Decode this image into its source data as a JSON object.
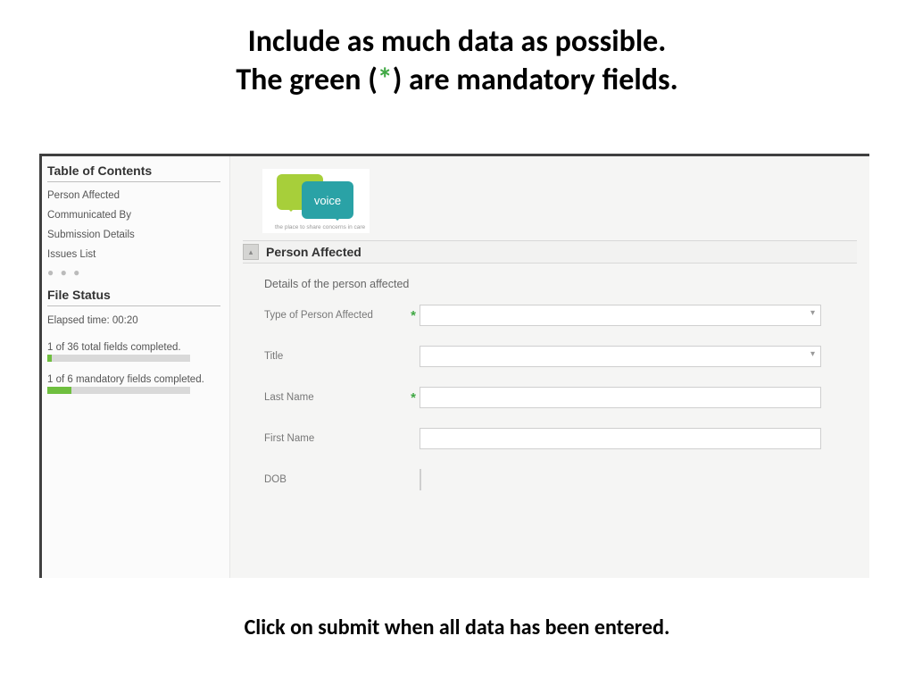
{
  "heading": {
    "line1": "Include as much data as possible.",
    "line2_a": "The green (",
    "line2_star": "*",
    "line2_b": ") are mandatory fields."
  },
  "sidebar": {
    "toc_title": "Table of Contents",
    "items": [
      {
        "label": "Person Affected"
      },
      {
        "label": "Communicated By"
      },
      {
        "label": "Submission Details"
      },
      {
        "label": "Issues List"
      }
    ],
    "filestatus_title": "File Status",
    "elapsed": "Elapsed time: 00:20",
    "total_fields_text": "1 of 36 total fields completed.",
    "total_fields_pct": 3,
    "mandatory_fields_text": "1 of 6 mandatory fields completed.",
    "mandatory_fields_pct": 17
  },
  "logo": {
    "word": "voice",
    "tag": "the place to share concerns in care"
  },
  "section": {
    "title": "Person Affected",
    "subtitle": "Details of the person affected"
  },
  "fields": {
    "type": {
      "label": "Type of Person Affected",
      "required": true,
      "kind": "select"
    },
    "title": {
      "label": "Title",
      "required": false,
      "kind": "select"
    },
    "lastname": {
      "label": "Last Name",
      "required": true,
      "kind": "text"
    },
    "firstname": {
      "label": "First Name",
      "required": false,
      "kind": "text"
    },
    "dob": {
      "label": "DOB",
      "required": false,
      "kind": "date"
    }
  },
  "required_mark": "*",
  "collapse_glyph": "▴",
  "footer": "Click on submit when all data has been entered."
}
